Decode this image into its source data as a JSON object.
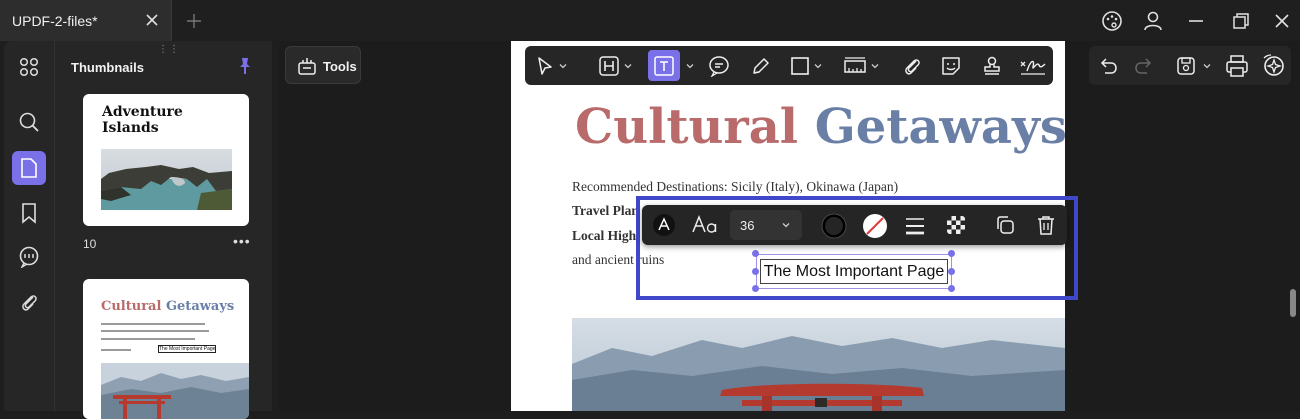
{
  "window": {
    "tab_title": "UPDF-2-files*"
  },
  "icons": {
    "tab_close": "close-icon",
    "new_tab": "plus-icon",
    "theme": "palette-icon",
    "account": "user-icon",
    "minimize": "minimize-icon",
    "maximize": "restore-icon",
    "close": "close-icon"
  },
  "sidebar": {
    "items": [
      {
        "name": "apps",
        "icon": "grid-icon"
      },
      {
        "name": "search",
        "icon": "search-icon"
      },
      {
        "name": "pages",
        "icon": "page-icon",
        "active": true
      },
      {
        "name": "bookmarks",
        "icon": "bookmark-icon"
      },
      {
        "name": "comments",
        "icon": "comment-icon"
      },
      {
        "name": "attachments",
        "icon": "paperclip-icon"
      }
    ]
  },
  "thumbnails": {
    "title": "Thumbnails",
    "page1_title": "Adventure Islands",
    "page_number": "10",
    "more": "•••",
    "page2_title_part1": "Cultural",
    "page2_title_part2": "Getaways",
    "page2_box_text": "The Most Important Page"
  },
  "tools": {
    "label": "Tools"
  },
  "document": {
    "title_part1": "Cultural",
    "title_part2": "Getaways",
    "line1": "Recommended Destinations: Sicily (Italy), Okinawa (Japan)",
    "line2": "Travel Plan",
    "line3": "Local High",
    "line4": "and ancient ruins",
    "textbox": "The Most Important Page"
  },
  "format_toolbar": {
    "font_size": "36"
  },
  "colors": {
    "accent": "#7a71e8",
    "selection": "#4047c8",
    "title_red": "#b96a6a",
    "title_blue": "#6a7fa6"
  }
}
